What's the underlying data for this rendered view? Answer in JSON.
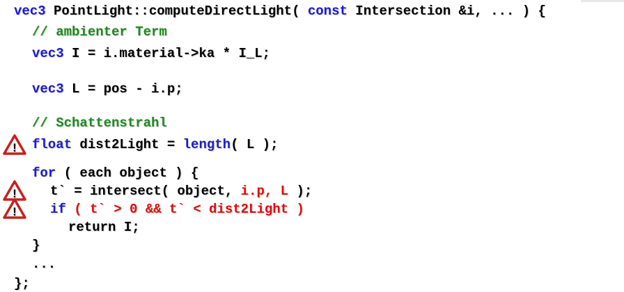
{
  "code": {
    "header": {
      "kw_vec3": "vec3",
      "sig1": " PointLight::computeDirectLight( ",
      "kw_const": "const",
      "sig2": " Intersection &i, ... ) {"
    },
    "comment_ambient": "// ambienter Term",
    "line_I": {
      "kw": "vec3",
      "rest": " I = i.material->ka * I_L;"
    },
    "line_L": {
      "kw": "vec3",
      "rest": " L = pos - i.p;"
    },
    "comment_shadow": "// Schattenstrahl",
    "line_dist": {
      "kw": "float",
      "mid": " dist2Light = ",
      "fn": "length",
      "rest": "( L );"
    },
    "line_for": {
      "kw": "for",
      "rest": " ( each object ) {"
    },
    "line_t": {
      "pre": "t` = intersect( object, ",
      "red": "i.p, L",
      "post": " );"
    },
    "line_if": {
      "kw": "if",
      "red": " ( t` > 0 && t` < dist2Light )"
    },
    "line_return": "return I;",
    "line_close_for": "}",
    "line_dots": "...",
    "line_end": "};"
  },
  "warnings": {
    "icon": "warning-triangle-icon",
    "glyph": "!",
    "color": "#c8201d"
  }
}
